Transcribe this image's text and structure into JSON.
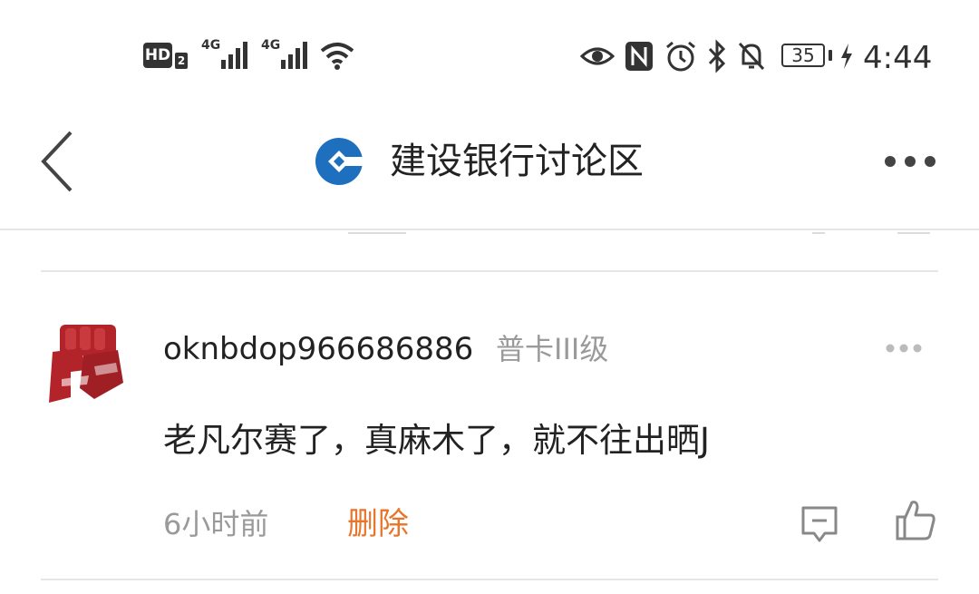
{
  "status_bar": {
    "hd_label": "HD",
    "hd_sub": "2",
    "net1": "4G",
    "net2": "4G",
    "battery": "35",
    "time": "4:44",
    "icons": [
      "hd-icon",
      "signal-icon",
      "signal-icon",
      "wifi-icon",
      "eye-icon",
      "nfc-icon",
      "alarm-icon",
      "bluetooth-icon",
      "mute-icon",
      "battery-icon",
      "charging-icon"
    ]
  },
  "header": {
    "title": "建设银行讨论区",
    "logo": "ccb-logo",
    "back_icon": "back-chevron-icon",
    "more_icon": "more-dots-icon",
    "brand_color": "#1f6fbf"
  },
  "comment": {
    "username": "oknbdop966686886",
    "level": "普卡III级",
    "content": "老凡尔赛了，真麻木了，就不往出晒J",
    "time": "6小时前",
    "delete_label": "删除",
    "delete_color": "#e8752a",
    "avatar": "raised-fist-avatar",
    "reply_icon": "reply-icon",
    "like_icon": "thumbs-up-icon"
  }
}
